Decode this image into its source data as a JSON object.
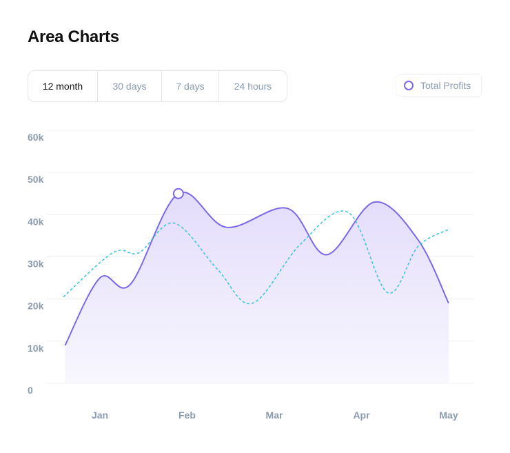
{
  "header": {
    "title": "Area Charts"
  },
  "tabs": [
    {
      "label": "12 month",
      "active": true
    },
    {
      "label": "30 days",
      "active": false
    },
    {
      "label": "7 days",
      "active": false
    },
    {
      "label": "24 hours",
      "active": false
    }
  ],
  "legend": {
    "label": "Total Profits",
    "color": "#7b68e8"
  },
  "chart_data": {
    "type": "area",
    "x_tick_labels": [
      "Jan",
      "Feb",
      "Mar",
      "Apr",
      "May"
    ],
    "y_tick_labels": [
      "0",
      "10k",
      "20k",
      "30k",
      "40k",
      "50k",
      "60k"
    ],
    "ylim": [
      0,
      60000
    ],
    "x_range": [
      0.58,
      5.0
    ],
    "grid": true,
    "legend_position": "top-right",
    "series": [
      {
        "name": "Total Profits",
        "style": "area-solid",
        "color": "#7b68e8",
        "x": [
          0.6,
          1.0,
          1.35,
          1.9,
          2.45,
          3.15,
          3.6,
          4.15,
          4.65,
          5.0
        ],
        "values": [
          9000,
          25000,
          23500,
          45000,
          37000,
          41500,
          30500,
          43000,
          34000,
          19000
        ]
      },
      {
        "name": "",
        "style": "line-dashed",
        "color": "#3ec5e0",
        "x": [
          0.58,
          1.15,
          1.45,
          1.85,
          2.35,
          2.75,
          3.3,
          3.85,
          4.3,
          4.65,
          5.0
        ],
        "values": [
          20500,
          31000,
          31000,
          38000,
          27000,
          19000,
          33000,
          40500,
          21500,
          32500,
          36500
        ]
      }
    ],
    "highlight_point": {
      "x": 1.9,
      "value": 45000
    }
  }
}
